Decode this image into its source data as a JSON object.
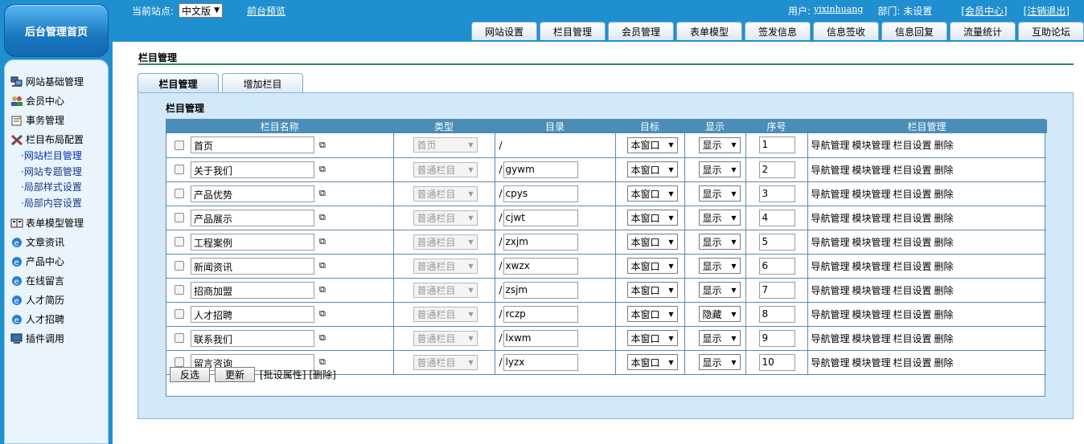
{
  "header": {
    "logo": "后台管理首页",
    "site_label": "当前站点:",
    "site_value": "中文版",
    "preview": "前台预览",
    "user_label": "用户:",
    "user_name": "yixinhuang",
    "dept": "部门: 未设置",
    "member_center": "[会员中心]",
    "logout": "[注销退出]"
  },
  "main_tabs": [
    "网站设置",
    "栏目管理",
    "会员管理",
    "表单模型",
    "签发信息",
    "信息签收",
    "信息回复",
    "流量统计",
    "互助论坛"
  ],
  "sidebar": {
    "items": [
      {
        "label": "网站基础管理",
        "icon": "computers-icon"
      },
      {
        "label": "会员中心",
        "icon": "users-icon"
      },
      {
        "label": "事务管理",
        "icon": "clipboard-icon"
      },
      {
        "label": "栏目布局配置",
        "icon": "tools-icon"
      },
      {
        "label": "表单模型管理",
        "icon": "book-icon"
      },
      {
        "label": "文章资讯",
        "icon": "ie-icon"
      },
      {
        "label": "产品中心",
        "icon": "ie-icon"
      },
      {
        "label": "在线留言",
        "icon": "ie-icon"
      },
      {
        "label": "人才简历",
        "icon": "ie-icon"
      },
      {
        "label": "人才招聘",
        "icon": "ie-icon"
      },
      {
        "label": "插件调用",
        "icon": "monitor-icon"
      }
    ],
    "sub_items": [
      "·网站栏目管理",
      "·网站专题管理",
      "·局部样式设置",
      "·局部内容设置"
    ]
  },
  "page": {
    "title": "栏目管理",
    "tab_manage": "栏目管理",
    "tab_add": "增加栏目",
    "panel_title": "栏目管理"
  },
  "table": {
    "headers": [
      "栏目名称",
      "类型",
      "目录",
      "目标",
      "显示",
      "序号",
      "栏目管理"
    ],
    "ops": [
      "导航管理",
      "模块管理",
      "栏目设置",
      "删除"
    ],
    "rows": [
      {
        "name": "首页",
        "type": "首页",
        "dir": "",
        "target": "本窗口",
        "show": "显示",
        "order": "1"
      },
      {
        "name": "关于我们",
        "type": "普通栏目",
        "dir": "gywm",
        "target": "本窗口",
        "show": "显示",
        "order": "2"
      },
      {
        "name": "产品优势",
        "type": "普通栏目",
        "dir": "cpys",
        "target": "本窗口",
        "show": "显示",
        "order": "3"
      },
      {
        "name": "产品展示",
        "type": "普通栏目",
        "dir": "cjwt",
        "target": "本窗口",
        "show": "显示",
        "order": "4"
      },
      {
        "name": "工程案例",
        "type": "普通栏目",
        "dir": "zxjm",
        "target": "本窗口",
        "show": "显示",
        "order": "5"
      },
      {
        "name": "新闻资讯",
        "type": "普通栏目",
        "dir": "xwzx",
        "target": "本窗口",
        "show": "显示",
        "order": "6"
      },
      {
        "name": "招商加盟",
        "type": "普通栏目",
        "dir": "zsjm",
        "target": "本窗口",
        "show": "显示",
        "order": "7"
      },
      {
        "name": "人才招聘",
        "type": "普通栏目",
        "dir": "rczp",
        "target": "本窗口",
        "show": "隐藏",
        "order": "8"
      },
      {
        "name": "联系我们",
        "type": "普通栏目",
        "dir": "lxwm",
        "target": "本窗口",
        "show": "显示",
        "order": "9"
      },
      {
        "name": "留言咨询",
        "type": "普通栏目",
        "dir": "lyzx",
        "target": "本窗口",
        "show": "显示",
        "order": "10"
      }
    ]
  },
  "footer": {
    "invert": "反选",
    "refresh": "更新",
    "batch": "[批设属性]",
    "delete": "[删除]"
  }
}
